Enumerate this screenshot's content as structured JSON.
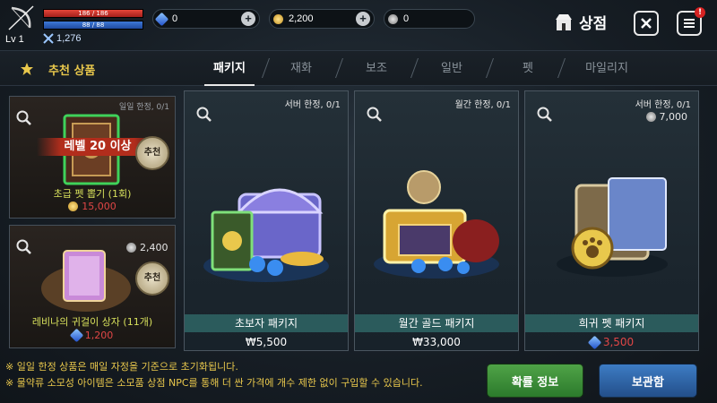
{
  "player": {
    "level": "Lv 1",
    "hp": "186 / 186",
    "mp": "88 / 88",
    "power": "1,276"
  },
  "currencies": [
    {
      "icon": "gem-icon",
      "value": "0"
    },
    {
      "icon": "gold-coin-icon",
      "value": "2,200"
    },
    {
      "icon": "silver-coin-icon",
      "value": "0"
    }
  ],
  "header": {
    "title": "상점",
    "close_icon": "close-icon",
    "menu_icon": "menu-icon",
    "menu_badge": "!"
  },
  "tabs": {
    "recommended": "추천 상품",
    "items": [
      "패키지",
      "재화",
      "보조",
      "일반",
      "펫",
      "마일리지"
    ],
    "active_index": 0
  },
  "side_items": [
    {
      "limit": "일일 한정, 0/1",
      "level_req": "레벨 20 이상",
      "badge": "추천",
      "title": "초급 펫 뽑기 (1회)",
      "price": "15,000",
      "currency": "gold"
    },
    {
      "bonus": "2,400",
      "badge": "추천",
      "title": "레비나의 귀걸이 상자 (11개)",
      "price": "1,200",
      "currency": "gem"
    }
  ],
  "products": [
    {
      "limit": "서버 한정, 0/1",
      "name": "초보자 패키지",
      "price": "₩5,500"
    },
    {
      "limit": "월간 한정, 0/1",
      "name": "월간 골드 패키지",
      "price": "₩33,000"
    },
    {
      "limit": "서버 한정, 0/1",
      "bonus": "7,000",
      "name": "희귀 펫 패키지",
      "price": "3,500",
      "currency": "gem"
    }
  ],
  "notes": [
    "※ 일일 한정 상품은 매일 자정을 기준으로 초기화됩니다.",
    "※ 물약류 소모성 아이템은 소모품 상점 NPC를 통해 더 싼 가격에 개수 제한 없이 구입할 수 있습니다."
  ],
  "buttons": {
    "probability": "확률 정보",
    "storage": "보관함"
  },
  "colors": {
    "accent_gold": "#e9c84c",
    "price_red": "#e04646",
    "green_button": "#3b8f38",
    "blue_button": "#2f67a8"
  }
}
